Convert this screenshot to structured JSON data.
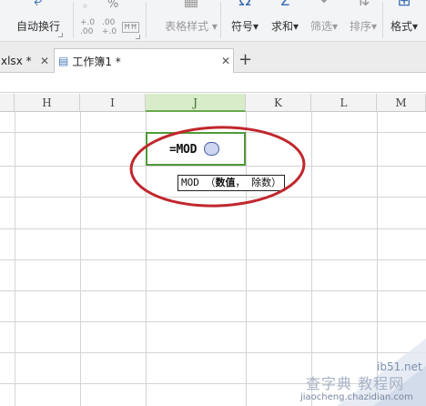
{
  "ribbon": {
    "autowrap_label": "自动换行",
    "percent_symbol": "%",
    "decimal_increase_symbol": "+.0\n.00",
    "decimal_decrease_symbol": ".00\n+.0",
    "table_style_label": "表格样式",
    "symbol_label": "符号",
    "symbol_icon_char": "Ω",
    "sum_label": "求和",
    "sum_icon_char": "Σ",
    "filter_label": "筛选",
    "sort_label": "排序",
    "format_label": "格式",
    "dropdown_char": "▾"
  },
  "tabs": [
    {
      "label": "xlsx *",
      "close": "✕"
    },
    {
      "label": "工作簿1 *",
      "close": "✕"
    }
  ],
  "new_tab_symbol": "+",
  "columns": [
    "H",
    "I",
    "J",
    "K",
    "L",
    "M"
  ],
  "selected_column": "J",
  "cell": {
    "formula": "=MOD"
  },
  "tooltip": {
    "func": "MOD",
    "open": "（",
    "arg1": "数值",
    "sep": "，",
    "arg2": "除数",
    "close": "）"
  },
  "watermark": {
    "domain_short": "ib51.net",
    "site_name": "查字典 教程网",
    "url": "jiaocheng.chazidian.com"
  },
  "colors": {
    "selection_green": "#4f9a38",
    "annotation_red": "#c1272d",
    "accent_blue": "#3b6fb6"
  }
}
